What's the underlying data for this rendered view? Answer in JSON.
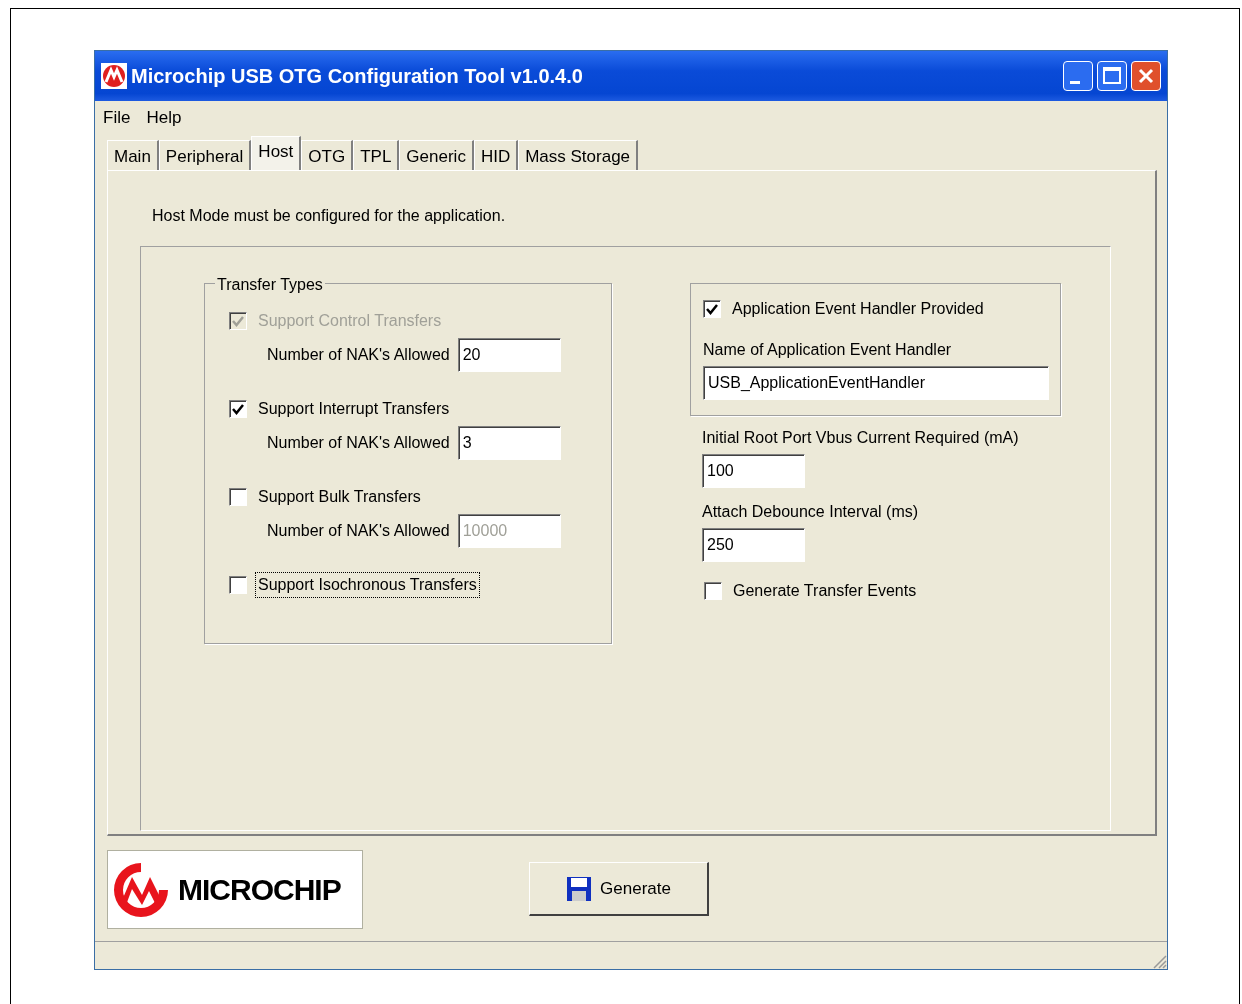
{
  "window": {
    "title": "Microchip USB OTG Configuration Tool v1.0.4.0"
  },
  "menu": [
    {
      "label": "File"
    },
    {
      "label": "Help"
    }
  ],
  "tabs": [
    {
      "label": "Main",
      "selected": false
    },
    {
      "label": "Peripheral",
      "selected": false
    },
    {
      "label": "Host",
      "selected": true
    },
    {
      "label": "OTG",
      "selected": false
    },
    {
      "label": "TPL",
      "selected": false
    },
    {
      "label": "Generic",
      "selected": false
    },
    {
      "label": "HID",
      "selected": false
    },
    {
      "label": "Mass Storage",
      "selected": false
    }
  ],
  "panel": {
    "intro": "Host Mode must be configured for the application.",
    "transfer_types": {
      "title": "Transfer Types",
      "items": [
        {
          "label": "Support Control Transfers",
          "checked": true,
          "disabled": true,
          "focused": false,
          "nak": {
            "label": "Number of NAK's Allowed",
            "value": "20",
            "disabled": false
          }
        },
        {
          "label": "Support Interrupt Transfers",
          "checked": true,
          "disabled": false,
          "focused": false,
          "nak": {
            "label": "Number of NAK's Allowed",
            "value": "3",
            "disabled": false
          }
        },
        {
          "label": "Support Bulk Transfers",
          "checked": false,
          "disabled": false,
          "focused": false,
          "nak": {
            "label": "Number of NAK's Allowed",
            "value": "10000",
            "disabled": true
          }
        },
        {
          "label": "Support Isochronous Transfers",
          "checked": false,
          "disabled": false,
          "focused": true
        }
      ]
    },
    "event_handler": {
      "label": "Application Event Handler Provided",
      "checked": true,
      "name_label": "Name of Application Event Handler",
      "name_value": "USB_ApplicationEventHandler"
    },
    "fields": [
      {
        "label": "Initial Root Port Vbus Current Required (mA)",
        "value": "100"
      },
      {
        "label": "Attach Debounce Interval (ms)",
        "value": "250"
      }
    ],
    "generate_events": {
      "label": "Generate Transfer Events",
      "checked": false
    }
  },
  "footer": {
    "logo_text": "MICROCHIP",
    "generate_button": "Generate"
  }
}
